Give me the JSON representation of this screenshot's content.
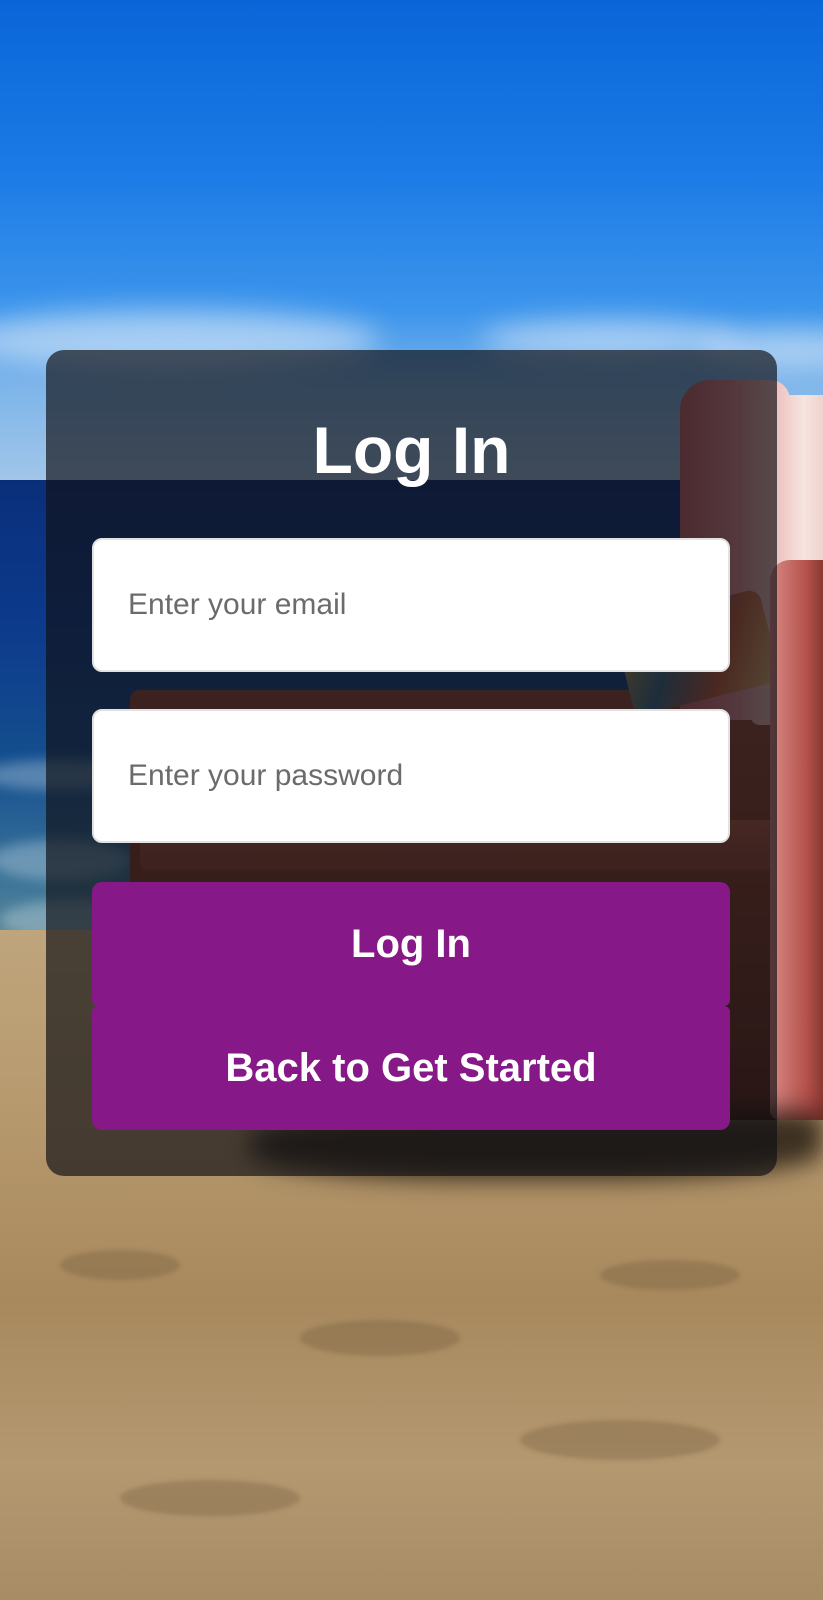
{
  "login": {
    "title": "Log In",
    "email": {
      "placeholder": "Enter your email",
      "value": ""
    },
    "password": {
      "placeholder": "Enter your password",
      "value": ""
    },
    "login_button_label": "Log In",
    "back_button_label": "Back to Get Started"
  },
  "colors": {
    "button_background": "#861887",
    "button_text": "#ffffff",
    "card_overlay": "rgba(16,16,20,0.68)",
    "field_background": "#ffffff",
    "placeholder_text": "#6b6b6b"
  },
  "background": {
    "description_icon": "beach-armchair-photo"
  }
}
